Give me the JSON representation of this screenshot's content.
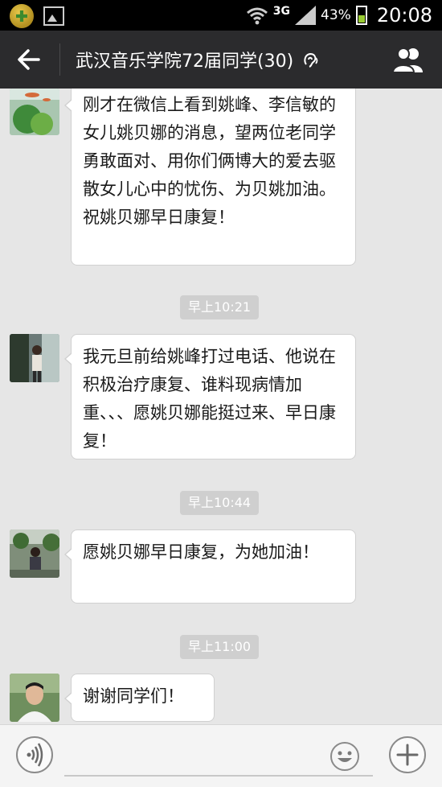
{
  "status_bar": {
    "network": "3G",
    "battery_percent": "43%",
    "battery_level": 0.43,
    "time": "20:08",
    "icons": [
      "app-notification-icon",
      "image-icon",
      "wifi-icon",
      "signal-icon",
      "battery-icon"
    ]
  },
  "header": {
    "title": "武汉音乐学院72届同学(30)",
    "icons": [
      "back-arrow-icon",
      "earpiece-icon",
      "group-members-icon"
    ]
  },
  "messages": [
    {
      "type": "text",
      "text": "刚才在微信上看到姚峰、李信敏的女儿姚贝娜的消息，望两位老同学勇敢面对、用你们俩博大的爱去驱散女儿心中的忧伤、为贝姚加油。祝姚贝娜早日康复！"
    },
    {
      "type": "time",
      "text": "早上10:21"
    },
    {
      "type": "text",
      "text": "我元旦前给姚峰打过电话、他说在积极治疗康复、谁料现病情加重、、、愿姚贝娜能挺过来、早日康复！"
    },
    {
      "type": "time",
      "text": "早上10:44"
    },
    {
      "type": "text",
      "text": "愿姚贝娜早日康复，为她加油！"
    },
    {
      "type": "time",
      "text": "早上11:00"
    },
    {
      "type": "text",
      "text": "谢谢同学们！"
    }
  ],
  "input_bar": {
    "icons": [
      "voice-icon",
      "emoji-icon",
      "plus-icon"
    ]
  },
  "colors": {
    "status_bar_bg": "#000000",
    "title_bar_bg": "#2b2b2d",
    "chat_bg": "#e6e6e6",
    "bubble_bg": "#ffffff",
    "timestamp_bg": "#cfcfcf",
    "battery_fill": "#99cc33"
  }
}
